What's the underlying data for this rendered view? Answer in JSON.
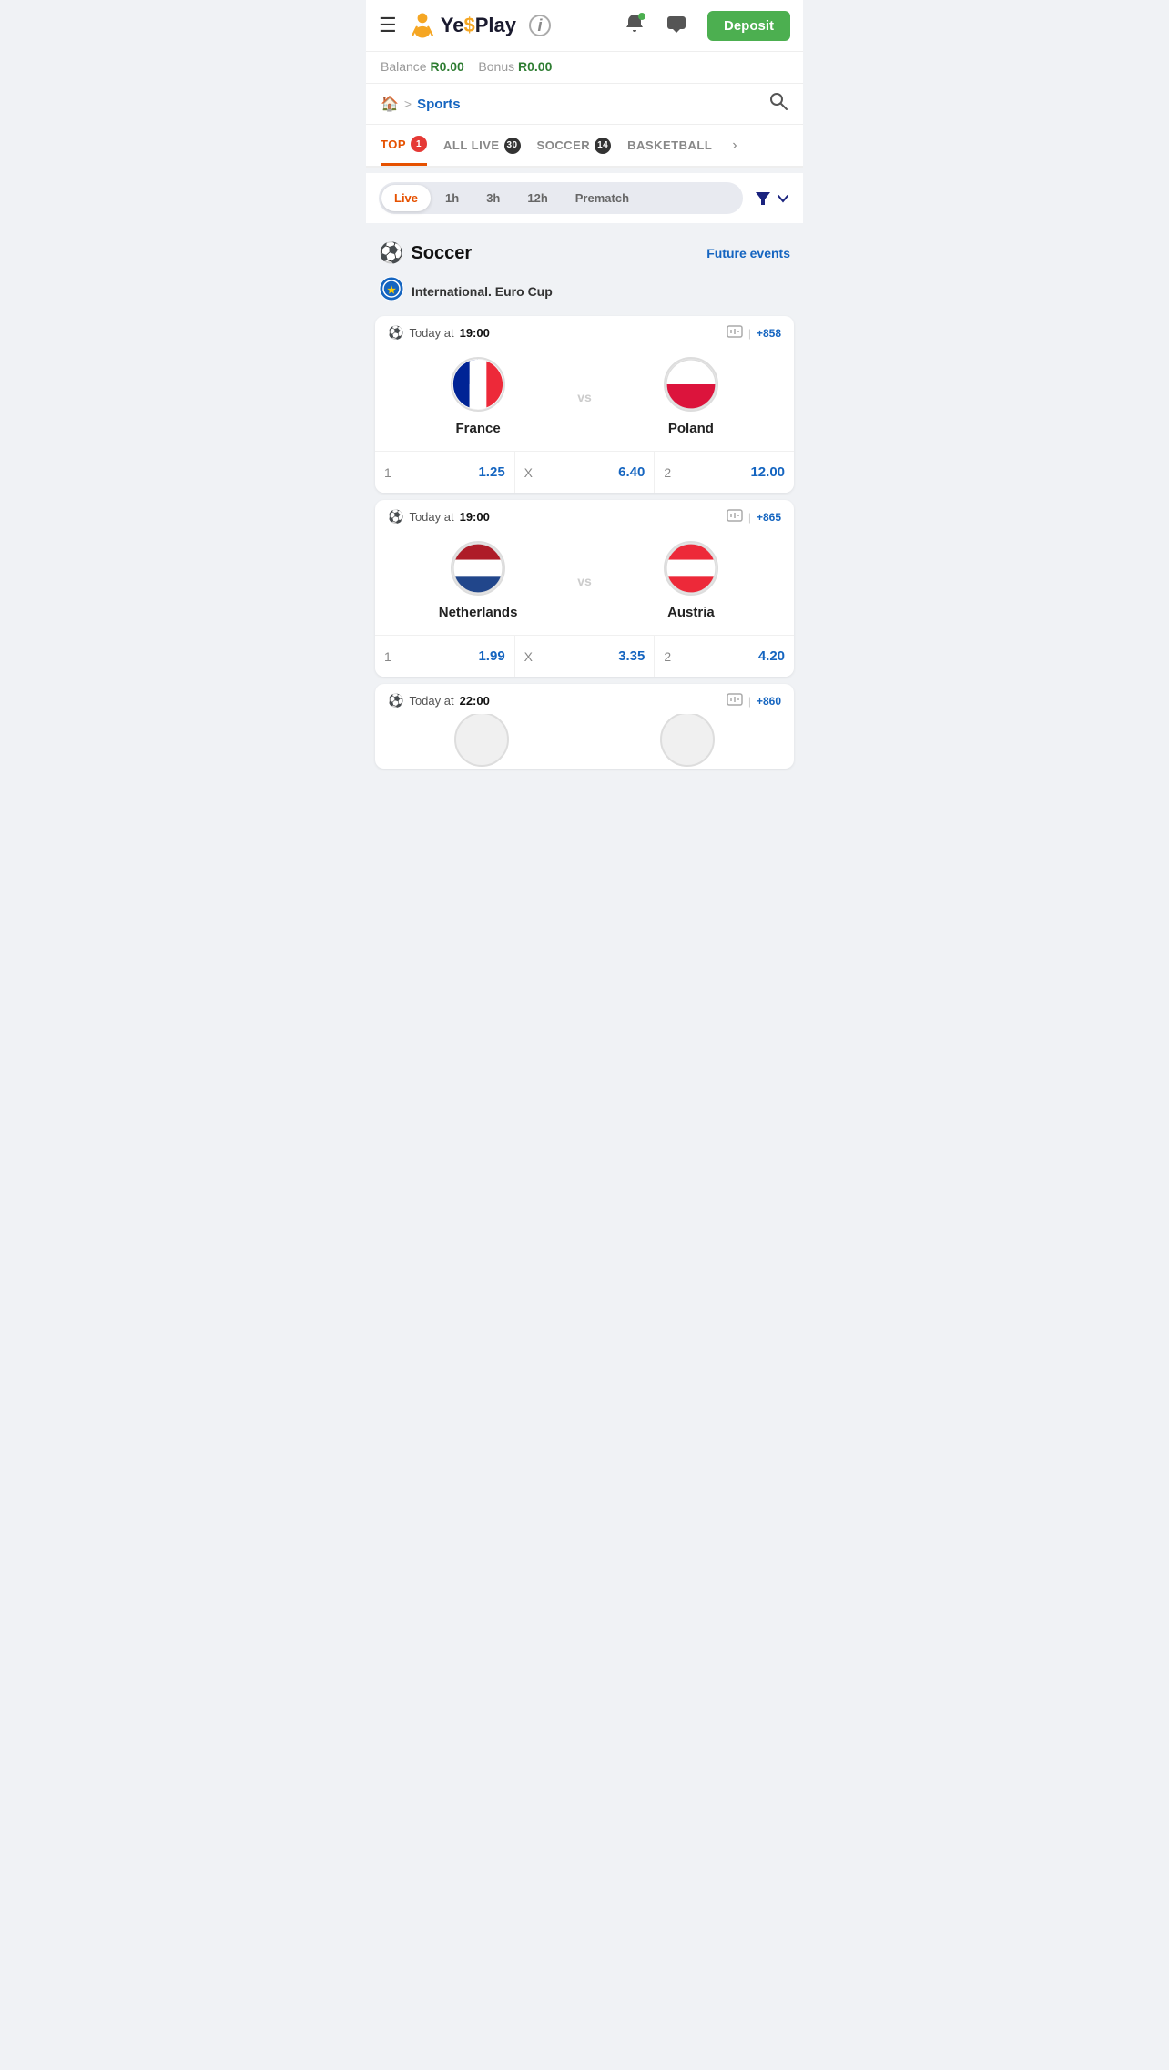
{
  "header": {
    "menu_label": "☰",
    "logo_text_dark": "Ye",
    "logo_text_accent": "$",
    "logo_text_rest": "Play",
    "info_label": "ℹ",
    "bell_label": "🔔",
    "chat_label": "💬",
    "deposit_label": "Deposit"
  },
  "balance": {
    "balance_label": "Balance",
    "balance_amount": "R0.00",
    "bonus_label": "Bonus",
    "bonus_amount": "R0.00"
  },
  "breadcrumb": {
    "home_icon": "🏠",
    "separator": ">",
    "current": "Sports"
  },
  "tabs": [
    {
      "id": "top",
      "label": "TOP",
      "badge": "1",
      "badge_dark": false,
      "active": true
    },
    {
      "id": "all-live",
      "label": "ALL LIVE",
      "badge": "30",
      "badge_dark": true,
      "active": false
    },
    {
      "id": "soccer",
      "label": "SOCCER",
      "badge": "14",
      "badge_dark": true,
      "active": false
    },
    {
      "id": "basketball",
      "label": "BASKETBALL",
      "badge": "",
      "badge_dark": false,
      "active": false
    }
  ],
  "filters": [
    {
      "id": "live",
      "label": "Live",
      "active": true
    },
    {
      "id": "1h",
      "label": "1h",
      "active": false
    },
    {
      "id": "3h",
      "label": "3h",
      "active": false
    },
    {
      "id": "12h",
      "label": "12h",
      "active": false
    },
    {
      "id": "prematch",
      "label": "Prematch",
      "active": false
    }
  ],
  "sports_section": {
    "icon": "⚽",
    "title": "Soccer",
    "future_events_label": "Future events",
    "league": {
      "icon": "🌍",
      "name": "International. Euro Cup"
    },
    "matches": [
      {
        "id": "match1",
        "time_label": "Today at",
        "time_value": "19:00",
        "stats_icon": "📊",
        "stats_label": "+858",
        "home_team": {
          "name": "France",
          "flag": "france"
        },
        "away_team": {
          "name": "Poland",
          "flag": "poland"
        },
        "odds": [
          {
            "label": "1",
            "value": "1.25"
          },
          {
            "label": "X",
            "value": "6.40"
          },
          {
            "label": "2",
            "value": "12.00"
          }
        ]
      },
      {
        "id": "match2",
        "time_label": "Today at",
        "time_value": "19:00",
        "stats_icon": "📊",
        "stats_label": "+865",
        "home_team": {
          "name": "Netherlands",
          "flag": "netherlands"
        },
        "away_team": {
          "name": "Austria",
          "flag": "austria"
        },
        "odds": [
          {
            "label": "1",
            "value": "1.99"
          },
          {
            "label": "X",
            "value": "3.35"
          },
          {
            "label": "2",
            "value": "4.20"
          }
        ]
      },
      {
        "id": "match3",
        "time_label": "Today at",
        "time_value": "22:00",
        "stats_icon": "📊",
        "stats_label": "+860",
        "home_team": {
          "name": "",
          "flag": "partial1"
        },
        "away_team": {
          "name": "",
          "flag": "partial2"
        },
        "odds": []
      }
    ]
  }
}
